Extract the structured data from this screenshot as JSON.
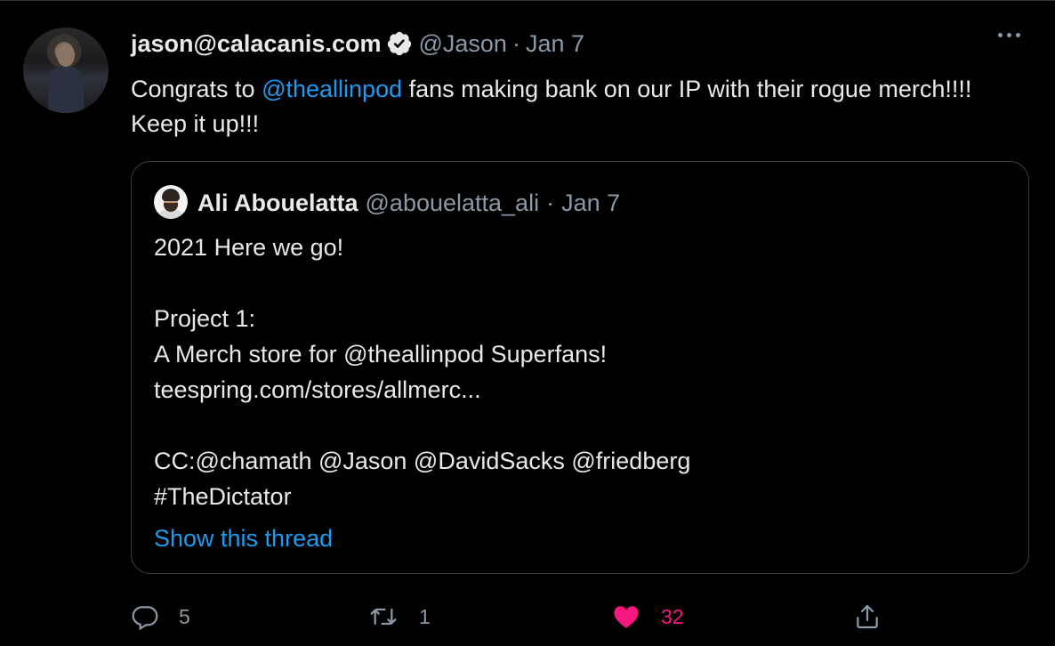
{
  "tweet": {
    "author_name": "jason@calacanis.com",
    "handle": "@Jason",
    "separator": "·",
    "date": "Jan 7",
    "text_before": "Congrats to ",
    "mention": "@theallinpod",
    "text_after": " fans making bank on our IP with their rogue merch!!!! Keep it up!!!"
  },
  "quoted": {
    "author_name": "Ali Abouelatta",
    "handle": "@abouelatta_ali",
    "separator": "·",
    "date": "Jan 7",
    "lines": [
      "2021 Here we go!",
      "",
      "Project 1:",
      "A Merch store for @theallinpod Superfans!",
      "teespring.com/stores/allmerc...",
      "",
      "CC:@chamath @Jason @DavidSacks @friedberg",
      "#TheDictator"
    ],
    "show_thread": "Show this thread"
  },
  "actions": {
    "reply_count": "5",
    "retweet_count": "1",
    "like_count": "32"
  },
  "icons": {
    "more": "more-icon",
    "verified": "verified-badge-icon",
    "reply": "reply-icon",
    "retweet": "retweet-icon",
    "like": "heart-icon",
    "share": "share-icon"
  },
  "colors": {
    "background": "#000000",
    "accent": "#1d9bf0",
    "like": "#f91880",
    "muted": "#8b98a5"
  }
}
